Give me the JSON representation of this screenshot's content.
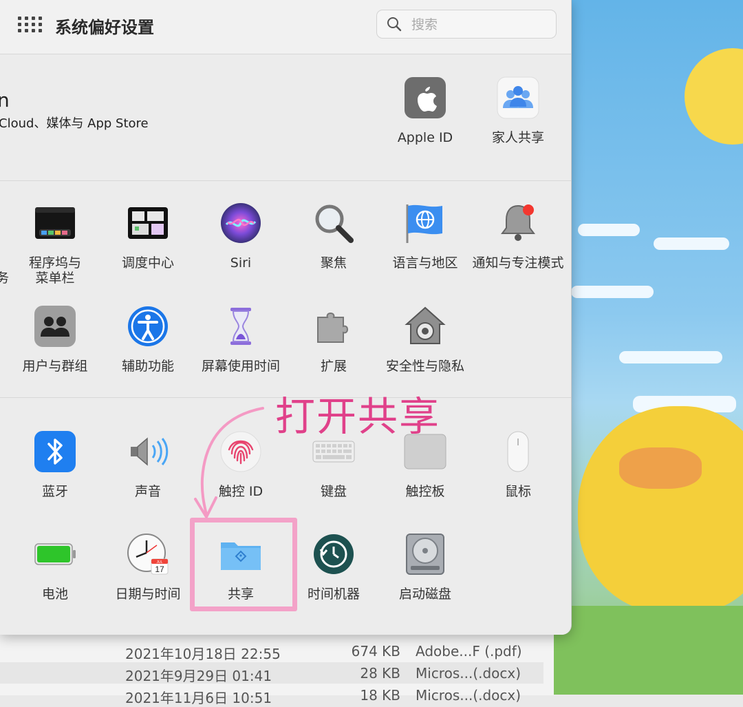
{
  "window": {
    "title": "系统偏好设置",
    "search_placeholder": "搜索"
  },
  "account": {
    "name_fragment": "n",
    "subtitle_fragment": "Cloud、媒体与 App Store",
    "items": [
      {
        "label": "Apple ID",
        "icon": "apple-id-icon"
      },
      {
        "label": "家人共享",
        "icon": "family-sharing-icon"
      }
    ]
  },
  "section1": {
    "cut_label_fragment": "务",
    "row1": [
      {
        "label": "程序坞与\n菜单栏",
        "icon": "dock-icon"
      },
      {
        "label": "调度中心",
        "icon": "mission-control-icon"
      },
      {
        "label": "Siri",
        "icon": "siri-icon"
      },
      {
        "label": "聚焦",
        "icon": "spotlight-icon"
      },
      {
        "label": "语言与地区",
        "icon": "globe-flag-icon"
      },
      {
        "label": "通知与专注模式",
        "icon": "bell-icon"
      }
    ],
    "row2": [
      {
        "label": "用户与群组",
        "icon": "users-icon"
      },
      {
        "label": "辅助功能",
        "icon": "accessibility-icon"
      },
      {
        "label": "屏幕使用时间",
        "icon": "hourglass-icon"
      },
      {
        "label": "扩展",
        "icon": "puzzle-icon"
      },
      {
        "label": "安全性与隐私",
        "icon": "house-lock-icon"
      }
    ]
  },
  "section2": {
    "row1": [
      {
        "label": "蓝牙",
        "icon": "bluetooth-icon"
      },
      {
        "label": "声音",
        "icon": "speaker-icon"
      },
      {
        "label": "触控 ID",
        "icon": "fingerprint-icon"
      },
      {
        "label": "键盘",
        "icon": "keyboard-icon"
      },
      {
        "label": "触控板",
        "icon": "trackpad-icon"
      },
      {
        "label": "鼠标",
        "icon": "mouse-icon"
      }
    ],
    "row2": [
      {
        "label": "电池",
        "icon": "battery-icon"
      },
      {
        "label": "日期与时间",
        "icon": "clock-icon",
        "calendar_month": "JUL",
        "calendar_day": "17"
      },
      {
        "label": "共享",
        "icon": "shared-folder-icon"
      },
      {
        "label": "时间机器",
        "icon": "time-machine-icon"
      },
      {
        "label": "启动磁盘",
        "icon": "disk-icon"
      }
    ]
  },
  "annotation": {
    "text": "打开共享"
  },
  "file_list": [
    {
      "date": "2021年10月18日 22:55",
      "size": "674 KB",
      "kind": "Adobe...F (.pdf)"
    },
    {
      "date": "2021年9月29日 01:41",
      "size": "28 KB",
      "kind": "Micros...(.docx)"
    },
    {
      "date": "2021年11月6日 10:51",
      "size": "18 KB",
      "kind": "Micros...(.docx)"
    }
  ],
  "colors": {
    "annotation": "#e0418a",
    "annotation_box": "#f49ac4",
    "window_bg": "#ececec"
  }
}
